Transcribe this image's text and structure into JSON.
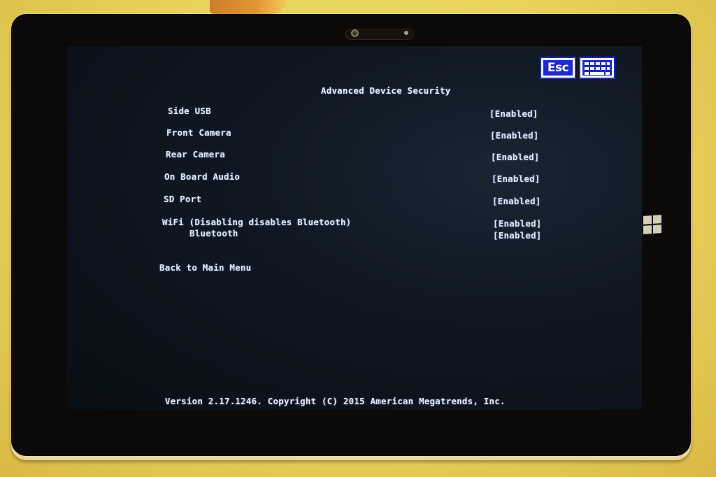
{
  "page": {
    "title": "Advanced Device Security",
    "colors": {
      "screen_bg": "#0c131c",
      "text": "#dfe6f4",
      "button_accent": "#1b28e0",
      "surface_bg": "#e9d35c"
    }
  },
  "toolbar": {
    "esc_label": "Esc",
    "keyboard_icon": "keyboard-icon"
  },
  "settings": [
    {
      "label": "Side USB",
      "value": "[Enabled]"
    },
    {
      "label": "Front Camera",
      "value": "[Enabled]"
    },
    {
      "label": "Rear Camera",
      "value": "[Enabled]"
    },
    {
      "label": "On Board Audio",
      "value": "[Enabled]"
    },
    {
      "label": "SD Port",
      "value": "[Enabled]"
    },
    {
      "label": "WiFi (Disabling disables Bluetooth)",
      "value": "[Enabled]"
    },
    {
      "label": "Bluetooth",
      "value": "[Enabled]"
    }
  ],
  "back_link": "Back to Main Menu",
  "footer": "Version 2.17.1246. Copyright (C) 2015 American Megatrends, Inc.",
  "device": {
    "home_icon": "windows-logo-icon",
    "camera_icon": "front-camera-icon"
  }
}
